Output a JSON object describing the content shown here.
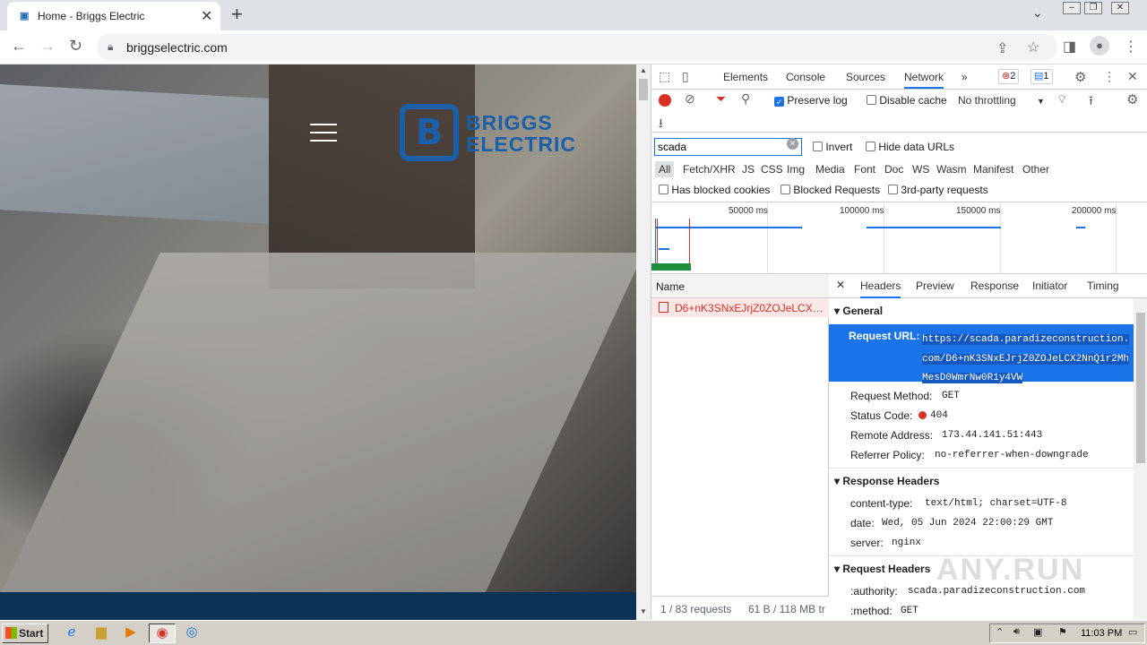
{
  "browser": {
    "tab_title": "Home - Briggs Electric",
    "url": "briggselectric.com"
  },
  "site": {
    "logo_line1": "BRIGGS",
    "logo_line2": "ELECTRIC"
  },
  "devtools": {
    "tabs": [
      "Elements",
      "Console",
      "Sources",
      "Network"
    ],
    "active_tab": "Network",
    "error_count": "2",
    "message_count": "1",
    "preserve_log_label": "Preserve log",
    "preserve_log_checked": true,
    "disable_cache_label": "Disable cache",
    "disable_cache_checked": false,
    "throttling": "No throttling",
    "filter_value": "scada",
    "invert_label": "Invert",
    "hide_data_urls_label": "Hide data URLs",
    "types": [
      "All",
      "Fetch/XHR",
      "JS",
      "CSS",
      "Img",
      "Media",
      "Font",
      "Doc",
      "WS",
      "Wasm",
      "Manifest",
      "Other"
    ],
    "has_blocked_cookies_label": "Has blocked cookies",
    "blocked_requests_label": "Blocked Requests",
    "third_party_label": "3rd-party requests",
    "timeline_ticks": [
      "50000 ms",
      "100000 ms",
      "150000 ms",
      "200000 ms"
    ],
    "name_header": "Name",
    "request_name": "D6+nK3SNxEJrjZ0ZOJeLCX2N...",
    "status_requests": "1 / 83 requests",
    "status_transfer": "61 B / 118 MB tr",
    "detail_tabs": [
      "Headers",
      "Preview",
      "Response",
      "Initiator",
      "Timing"
    ],
    "general_title": "General",
    "request_url_label": "Request URL:",
    "request_url": "https://scada.paradizeconstruction.com/D6+nK3SNxEJrjZ0ZOJeLCX2NnQ1r2MhMesD0WmrNw0R1y4VW",
    "request_method_label": "Request Method:",
    "request_method": "GET",
    "status_code_label": "Status Code:",
    "status_code": "404",
    "remote_address_label": "Remote Address:",
    "remote_address": "173.44.141.51:443",
    "referrer_policy_label": "Referrer Policy:",
    "referrer_policy": "no-referrer-when-downgrade",
    "response_headers_title": "Response Headers",
    "content_type_label": "content-type:",
    "content_type": "text/html; charset=UTF-8",
    "date_label": "date:",
    "date": "Wed, 05 Jun 2024 22:00:29 GMT",
    "server_label": "server:",
    "server": "nginx",
    "request_headers_title": "Request Headers",
    "authority_label": ":authority:",
    "authority": "scada.paradizeconstruction.com",
    "method_label": ":method:",
    "method": "GET",
    "watermark": "ANY.RUN"
  },
  "taskbar": {
    "start_label": "Start",
    "clock": "11:03 PM"
  }
}
